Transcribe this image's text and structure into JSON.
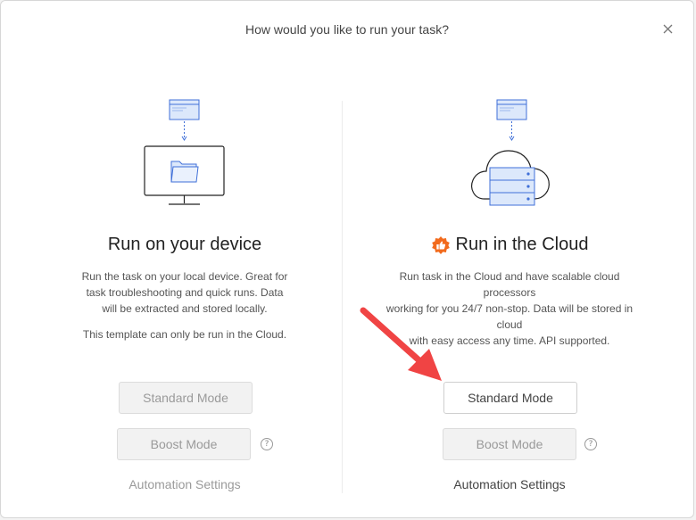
{
  "dialog": {
    "title": "How would you like to run your task?"
  },
  "device": {
    "heading": "Run on your device",
    "description_lines": [
      "Run the task on your local device. Great for",
      "task troubleshooting and quick runs. Data",
      "will be extracted and stored locally."
    ],
    "note": "This template can only be run in the Cloud.",
    "standard_mode": "Standard Mode",
    "boost_mode": "Boost Mode",
    "automation_settings": "Automation Settings"
  },
  "cloud": {
    "heading": "Run in the Cloud",
    "description_lines": [
      "Run task in the Cloud and have scalable cloud processors",
      "working for you 24/7 non-stop. Data will be stored in cloud",
      "with easy access any time. API supported."
    ],
    "standard_mode": "Standard Mode",
    "boost_mode": "Boost Mode",
    "automation_settings": "Automation Settings"
  },
  "help_glyph": "?",
  "colors": {
    "accent_orange": "#f26b1d",
    "arrow_red": "#f04444",
    "illustration_blue": "#3f6fd8",
    "illustration_fill": "#dce8fb"
  }
}
